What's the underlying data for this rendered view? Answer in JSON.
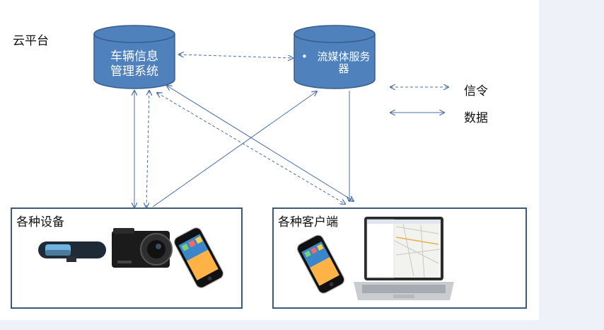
{
  "colors": {
    "cylinder_fill": "#4f81bd",
    "cylinder_stroke": "#385d8a",
    "arrow": "#4a6fa8",
    "box_border": "#3d5a78",
    "page_margin": "#eef1f8"
  },
  "cloud_label": "云平台",
  "nodes": {
    "vehicle_system": "车辆信息\n管理系统",
    "media_server": "流媒体服务器",
    "media_server_bullet": "•"
  },
  "legend": {
    "signal": "信令",
    "data": "数据"
  },
  "devices": {
    "title": "各种设备",
    "items": [
      "rearview-mirror-recorder",
      "dash-camera",
      "smartphone"
    ]
  },
  "clients": {
    "title": "各种客户端",
    "items": [
      "smartphone",
      "laptop"
    ]
  }
}
